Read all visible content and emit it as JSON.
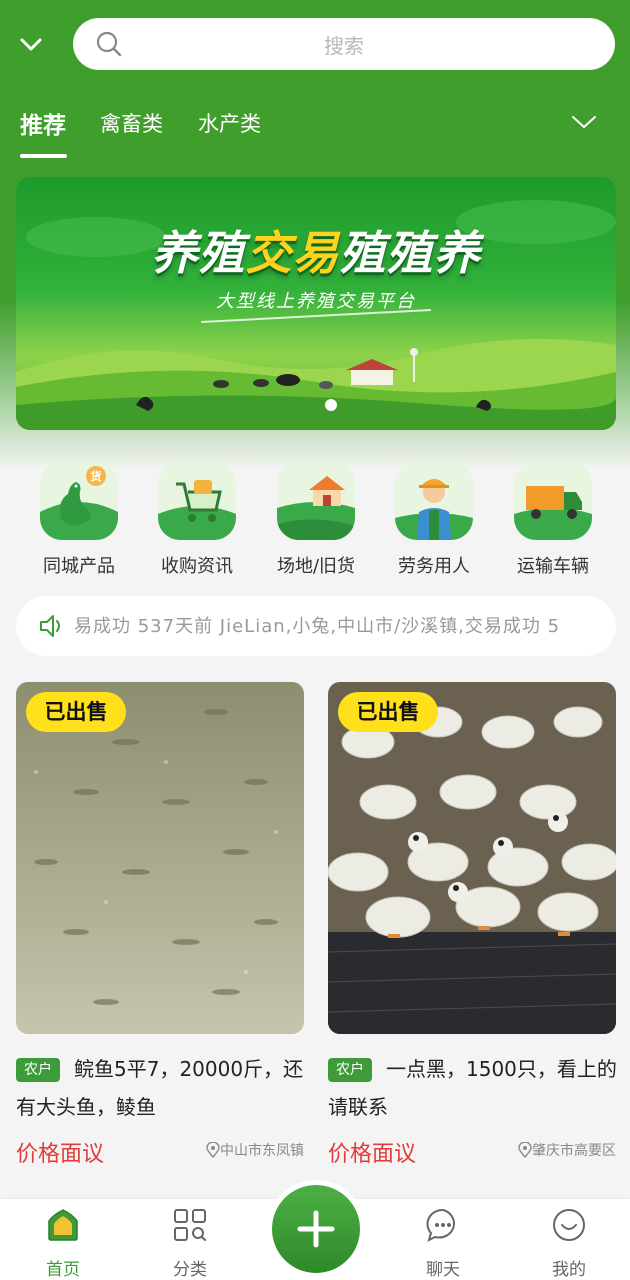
{
  "header": {
    "search_placeholder": "搜索"
  },
  "tabs": [
    {
      "label": "推荐",
      "active": true
    },
    {
      "label": "禽畜类",
      "active": false
    },
    {
      "label": "水产类",
      "active": false
    }
  ],
  "banner": {
    "title_part1": "养殖",
    "title_part2": "交易",
    "title_part3": "殖殖养",
    "subtitle": "大型线上养殖交易平台"
  },
  "quick_nav": [
    {
      "label": "同城产品",
      "icon": "goose-icon"
    },
    {
      "label": "收购资讯",
      "icon": "cart-icon"
    },
    {
      "label": "场地/旧货",
      "icon": "house-icon"
    },
    {
      "label": "劳务用人",
      "icon": "worker-icon"
    },
    {
      "label": "运输车辆",
      "icon": "truck-icon"
    }
  ],
  "quick_nav_badge": "货",
  "ticker": {
    "text": "易成功 537天前 JieLian,小兔,中山市/沙溪镇,交易成功 5"
  },
  "listings": [
    {
      "badge": "已出售",
      "tag": "农户",
      "title": "鲩鱼5平7，20000斤，还有大头鱼，鲮鱼",
      "price": "价格面议",
      "location": "中山市东凤镇"
    },
    {
      "badge": "已出售",
      "tag": "农户",
      "title": "一点黑，1500只，看上的请联系",
      "price": "价格面议",
      "location": "肇庆市高要区"
    }
  ],
  "bottom_nav": [
    {
      "label": "首页",
      "icon": "home-icon",
      "active": true
    },
    {
      "label": "分类",
      "icon": "grid-icon",
      "active": false
    },
    {
      "label": "聊天",
      "icon": "chat-icon",
      "active": false
    },
    {
      "label": "我的",
      "icon": "profile-icon",
      "active": false
    }
  ],
  "colors": {
    "brand_green": "#3f9e2c",
    "price_red": "#e23b3b",
    "badge_yellow": "#ffe01b"
  }
}
